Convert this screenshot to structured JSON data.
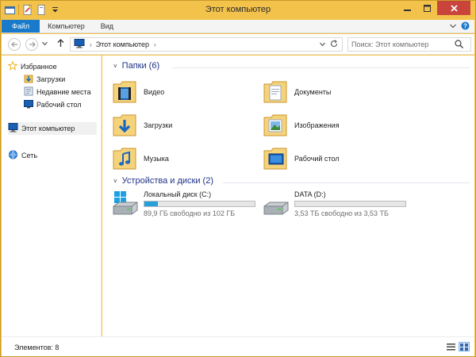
{
  "window": {
    "title": "Этот компьютер"
  },
  "ribbon": {
    "tabs": [
      {
        "label": "Файл"
      },
      {
        "label": "Компьютер"
      },
      {
        "label": "Вид"
      }
    ]
  },
  "nav": {
    "address_crumb": "Этот компьютер",
    "search_placeholder": "Поиск: Этот компьютер"
  },
  "sidebar": {
    "favorites": {
      "label": "Избранное"
    },
    "items": [
      {
        "label": "Загрузки"
      },
      {
        "label": "Недавние места"
      },
      {
        "label": "Рабочий стол"
      }
    ],
    "this_pc": {
      "label": "Этот компьютер"
    },
    "network": {
      "label": "Сеть"
    }
  },
  "content": {
    "folders_header": "Папки (6)",
    "folders": [
      {
        "label": "Видео",
        "icon": "video-folder-icon"
      },
      {
        "label": "Документы",
        "icon": "documents-folder-icon"
      },
      {
        "label": "Загрузки",
        "icon": "downloads-folder-icon"
      },
      {
        "label": "Изображения",
        "icon": "pictures-folder-icon"
      },
      {
        "label": "Музыка",
        "icon": "music-folder-icon"
      },
      {
        "label": "Рабочий стол",
        "icon": "desktop-folder-icon"
      }
    ],
    "drives_header": "Устройства и диски (2)",
    "drives": [
      {
        "label": "Локальный диск (C:)",
        "free_text": "89,9 ГБ свободно из 102 ГБ",
        "used_fraction": 0.12
      },
      {
        "label": "DATA (D:)",
        "free_text": "3,53 ТБ свободно из 3,53 ТБ",
        "used_fraction": 0.0
      }
    ]
  },
  "status": {
    "items_text": "Элементов: 8"
  },
  "colors": {
    "accent": "#1979ca",
    "title_bar": "#f3c24b",
    "header_text": "#1e3287",
    "usage_bar": "#26a0da"
  }
}
